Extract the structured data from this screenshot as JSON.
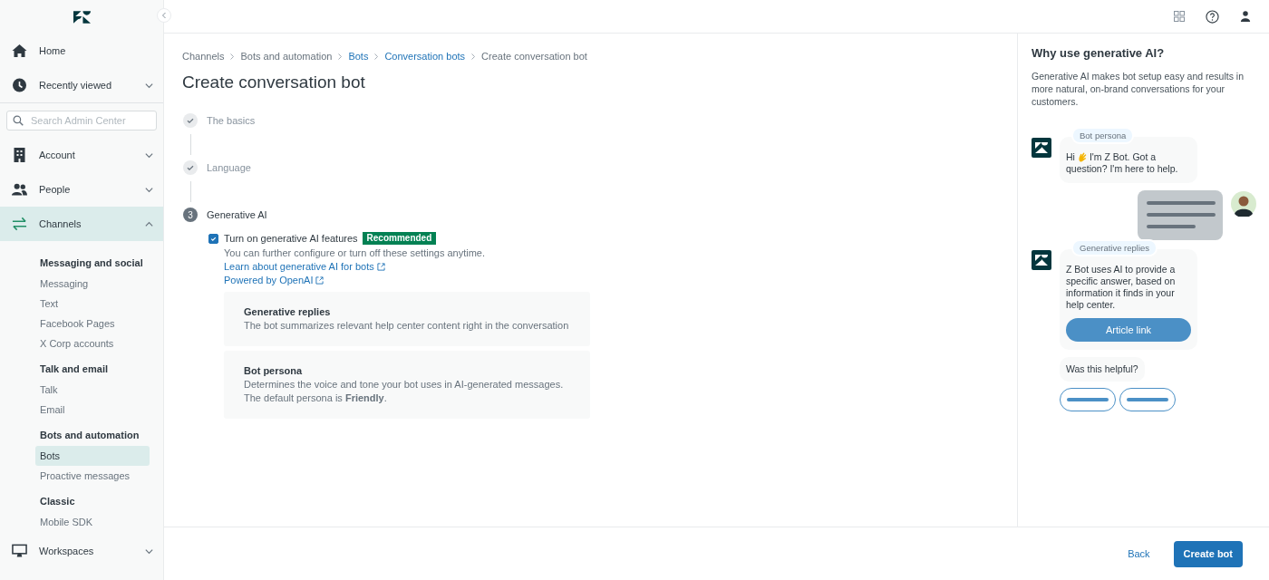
{
  "sidebar": {
    "top_items": [
      {
        "label": "Home",
        "selected": false
      },
      {
        "label": "Recently viewed",
        "expanded": false,
        "selected": false
      }
    ],
    "search": {
      "placeholder": "Search Admin Center"
    },
    "items": [
      {
        "label": "Account",
        "expanded": false,
        "selected": false
      },
      {
        "label": "People",
        "expanded": false,
        "selected": false
      },
      {
        "label": "Channels",
        "expanded": true,
        "selected": true
      }
    ],
    "channel_groups": [
      {
        "heading": "Messaging and social",
        "items": [
          {
            "label": "Messaging",
            "selected": false
          },
          {
            "label": "Text",
            "selected": false
          },
          {
            "label": "Facebook Pages",
            "selected": false
          },
          {
            "label": "X Corp accounts",
            "selected": false
          }
        ]
      },
      {
        "heading": "Talk and email",
        "items": [
          {
            "label": "Talk",
            "selected": false
          },
          {
            "label": "Email",
            "selected": false
          }
        ]
      },
      {
        "heading": "Bots and automation",
        "items": [
          {
            "label": "Bots",
            "selected": true
          },
          {
            "label": "Proactive messages",
            "selected": false
          }
        ]
      },
      {
        "heading": "Classic",
        "items": [
          {
            "label": "Mobile SDK",
            "selected": false
          }
        ]
      }
    ],
    "bottom_items": [
      {
        "label": "Workspaces",
        "expanded": false,
        "selected": false
      }
    ]
  },
  "breadcrumb": [
    {
      "label": "Channels",
      "kind": "text"
    },
    {
      "label": "Bots and automation",
      "kind": "text"
    },
    {
      "label": "Bots",
      "kind": "link"
    },
    {
      "label": "Conversation bots",
      "kind": "link"
    },
    {
      "label": "Create conversation bot",
      "kind": "text"
    }
  ],
  "title": "Create conversation bot",
  "steps": [
    {
      "label": "The basics",
      "kind": "done"
    },
    {
      "label": "Language",
      "kind": "done"
    },
    {
      "label": "Generative AI",
      "kind": "current",
      "number": "3"
    }
  ],
  "feature_toggle": {
    "label": "Turn on generative AI features",
    "checked": true,
    "badge": "Recommended",
    "hint": "You can further configure or turn off these settings anytime.",
    "links": [
      "Learn about generative AI for bots",
      "Powered by OpenAI"
    ]
  },
  "features": [
    {
      "title": "Generative replies",
      "lines": [
        "The bot summarizes relevant help center content right in the conversation"
      ]
    },
    {
      "title": "Bot persona",
      "lines": [
        "Determines the voice and tone your bot uses in AI-generated messages.",
        "The default persona is **Friendly**."
      ]
    }
  ],
  "info_panel": {
    "title": "Why use generative AI?",
    "text": "Generative AI makes bot setup easy and results in more natural, on-brand conversations for your customers.",
    "chat": [
      {
        "kind": "bot",
        "tag": "Bot persona",
        "greeting": "Hi",
        "lines": [
          "I'm Z Bot. Got a",
          "question? I'm here to help."
        ]
      },
      {
        "kind": "user"
      },
      {
        "kind": "bot",
        "tag": "Generative replies",
        "text": "Z Bot uses AI to provide a specific answer, based on information it finds in your help center.",
        "button": "Article link"
      },
      {
        "kind": "plain",
        "text": "Was this helpful?"
      },
      {
        "kind": "choices"
      }
    ]
  },
  "footer": {
    "back": "Back",
    "primary": "Create bot"
  }
}
